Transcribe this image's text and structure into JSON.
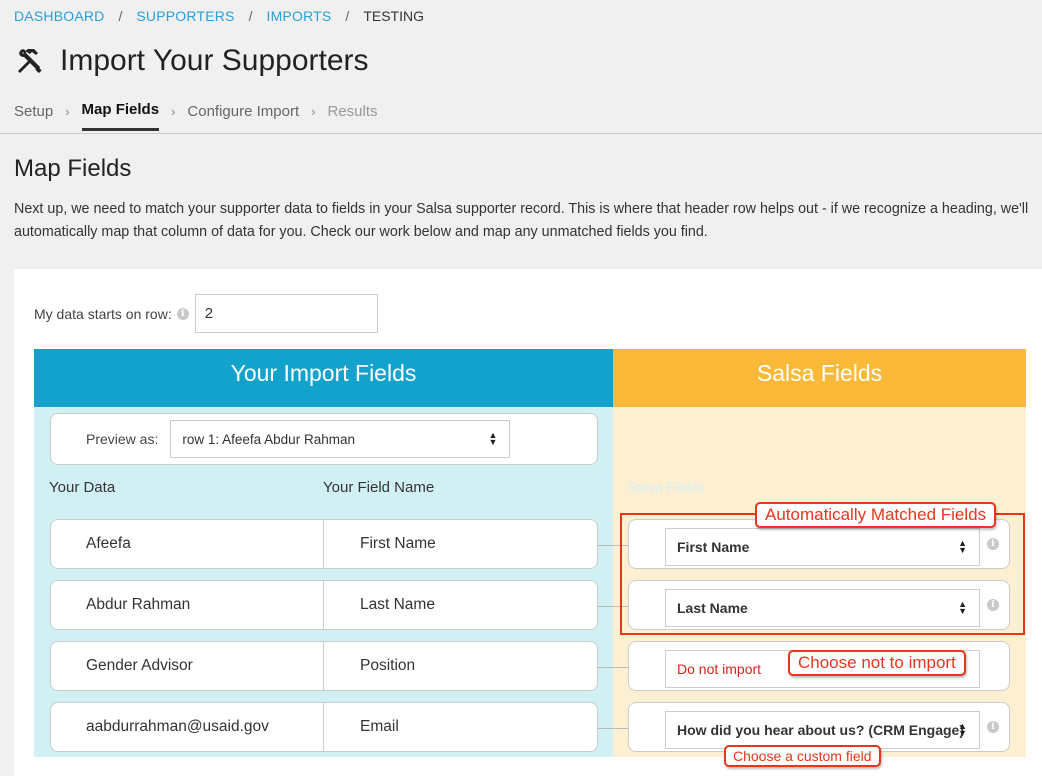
{
  "breadcrumb": {
    "items": [
      "DASHBOARD",
      "SUPPORTERS",
      "IMPORTS"
    ],
    "current": "TESTING",
    "separator": "/"
  },
  "page": {
    "title": "Import Your Supporters",
    "title_icon": "tools-icon"
  },
  "steps": [
    {
      "label": "Setup",
      "state": "done"
    },
    {
      "label": "Map Fields",
      "state": "active"
    },
    {
      "label": "Configure Import",
      "state": "todo"
    },
    {
      "label": "Results",
      "state": "disabled"
    }
  ],
  "section": {
    "title": "Map Fields",
    "intro": "Next up, we need to match your supporter data to fields in your Salsa supporter record. This is where that header row helps out - if we recognize a heading, we'll automatically map that column of data for you. Check our work below and map any unmatched fields you find."
  },
  "row_start": {
    "label": "My data starts on row:",
    "value": "2"
  },
  "import_fields": {
    "header": "Your Import Fields",
    "preview_label": "Preview as:",
    "preview_value": "row 1: Afeefa Abdur Rahman",
    "col_data": "Your Data",
    "col_field": "Your Field Name",
    "rows": [
      {
        "data": "Afeefa",
        "field": "First Name"
      },
      {
        "data": "Abdur Rahman",
        "field": "Last Name"
      },
      {
        "data": "Gender Advisor",
        "field": "Position"
      },
      {
        "data": "aabdurrahman@usaid.gov",
        "field": "Email"
      }
    ]
  },
  "salsa_fields": {
    "header": "Salsa Fields",
    "col_label": "Salsa Fields",
    "rows": [
      {
        "value": "First Name"
      },
      {
        "value": "Last Name"
      },
      {
        "value": "Do not import"
      },
      {
        "value": "How did you hear about us? (CRM Engage)"
      }
    ]
  },
  "annotations": {
    "auto_matched": "Automatically Matched Fields",
    "not_import": "Choose not to import",
    "custom_field": "Choose a custom field"
  },
  "colors": {
    "link": "#2a9fd6",
    "import_header": "#13a2cc",
    "import_bg": "#d1f0f4",
    "salsa_header": "#fbb93a",
    "salsa_bg": "#fdf0d2",
    "annotation": "#e8351c",
    "do_not_import": "#d0271b"
  }
}
